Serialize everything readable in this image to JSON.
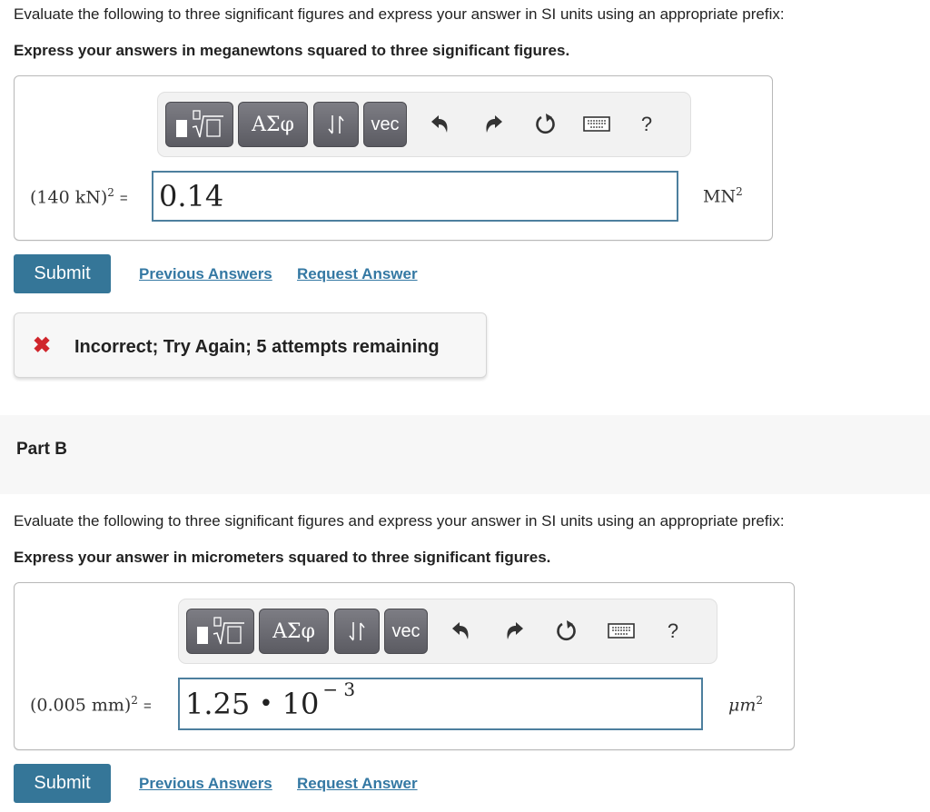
{
  "part_a": {
    "instruction": "Evaluate the following to three significant figures and express your answer in SI units using an appropriate prefix:",
    "bold_instruction": "Express your answers in meganewtons squared to three significant figures.",
    "toolbar": {
      "buttons": [
        "templates",
        "ΑΣφ",
        "⇃↾",
        "vec"
      ],
      "icons": [
        "undo-icon",
        "redo-icon",
        "reset-icon",
        "keyboard-icon",
        "help-icon"
      ],
      "help_label": "?"
    },
    "expression": "(140 kN)",
    "exponent": "2",
    "equals": "=",
    "answer_value": "0.14",
    "unit_base": "MN",
    "unit_exp": "2",
    "submit_label": "Submit",
    "previous_answers_label": "Previous Answers",
    "request_answer_label": "Request Answer",
    "feedback": {
      "icon": "✖",
      "text": "Incorrect; Try Again; 5 attempts remaining",
      "icon_color": "#d0262c"
    }
  },
  "part_b": {
    "title": "Part B",
    "instruction": "Evaluate the following to three significant figures and express your answer in SI units using an appropriate prefix:",
    "bold_instruction": "Express your answer in micrometers squared to three significant figures.",
    "toolbar": {
      "buttons": [
        "templates",
        "ΑΣφ",
        "⇃↾",
        "vec"
      ],
      "help_label": "?"
    },
    "expression": "(0.005 mm)",
    "exponent": "2",
    "equals": "=",
    "answer_mantissa": "1.25",
    "answer_times": "•",
    "answer_base": "10",
    "answer_exponent": "− 3",
    "unit_base": "μm",
    "unit_exp": "2",
    "submit_label": "Submit",
    "previous_answers_label": "Previous Answers",
    "request_answer_label": "Request Answer"
  },
  "colors": {
    "accent": "#357698",
    "link": "#3478a3",
    "input_border": "#4d7f9e",
    "error": "#d0262c"
  }
}
